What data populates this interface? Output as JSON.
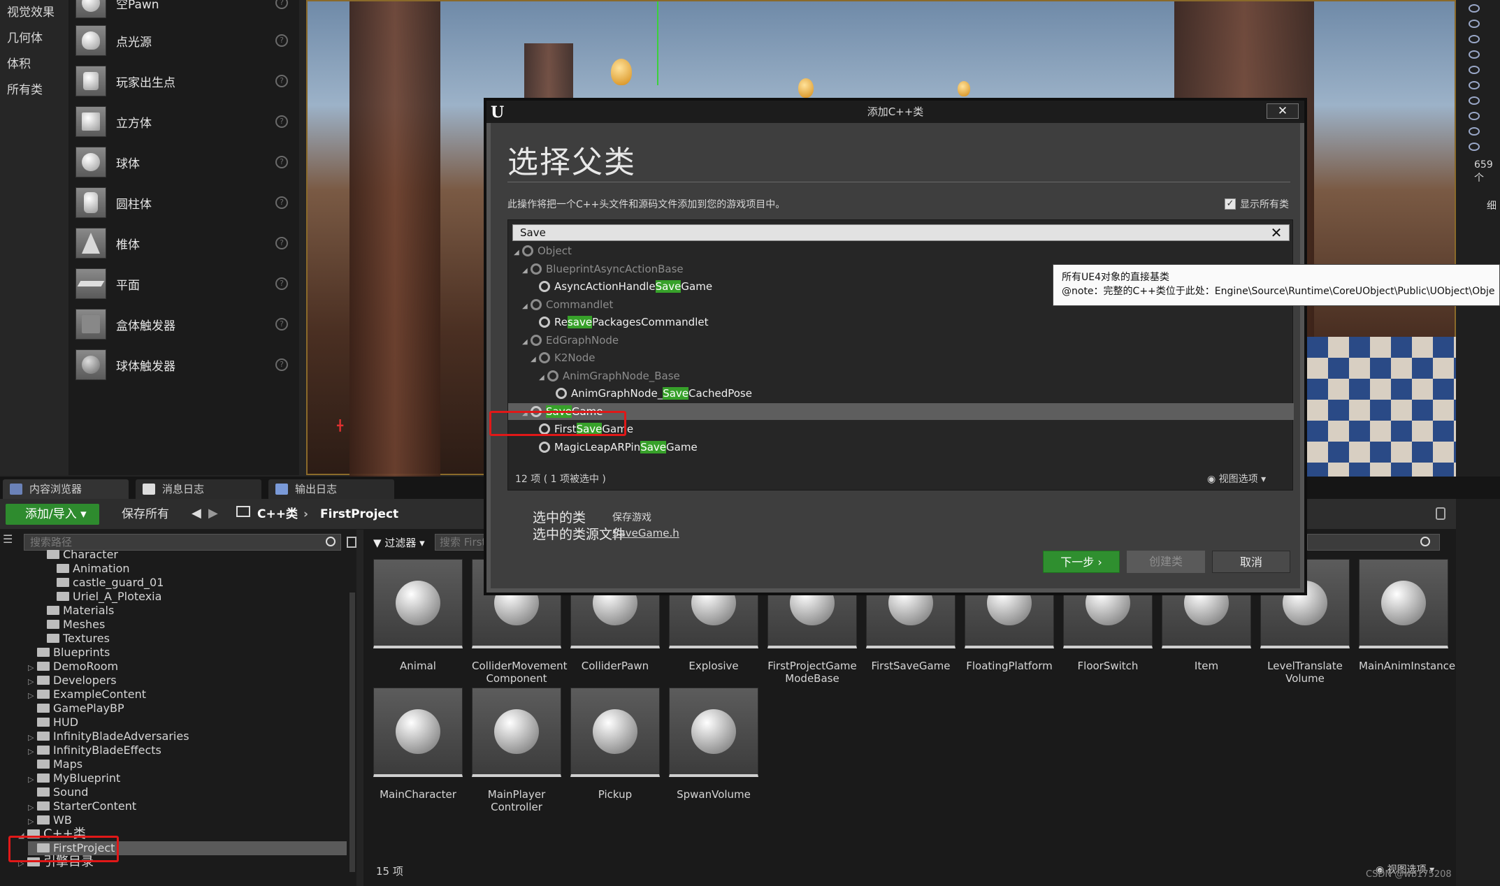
{
  "categories": [
    "视觉效果",
    "几何体",
    "体积",
    "所有类"
  ],
  "place_items": [
    {
      "label": "空Pawn"
    },
    {
      "label": "点光源"
    },
    {
      "label": "玩家出生点"
    },
    {
      "label": "立方体"
    },
    {
      "label": "球体"
    },
    {
      "label": "圆柱体"
    },
    {
      "label": "椎体"
    },
    {
      "label": "平面"
    },
    {
      "label": "盒体触发器"
    },
    {
      "label": "球体触发器"
    }
  ],
  "help_glyph": "?",
  "viewport": {
    "readout": "659个",
    "detail": "细"
  },
  "bottom_tabs": [
    "内容浏览器",
    "消息日志",
    "输出日志"
  ],
  "toolbar": {
    "add_import": "添加/导入",
    "save_all": "保存所有",
    "crumbs": [
      "C++类",
      "FirstProject"
    ]
  },
  "tree": {
    "search_placeholder": "搜索路径",
    "items": [
      {
        "label": "Character",
        "indent": 3
      },
      {
        "label": "Animation",
        "indent": 4
      },
      {
        "label": "castle_guard_01",
        "indent": 4
      },
      {
        "label": "Uriel_A_Plotexia",
        "indent": 4
      },
      {
        "label": "Materials",
        "indent": 3
      },
      {
        "label": "Meshes",
        "indent": 3
      },
      {
        "label": "Textures",
        "indent": 3
      },
      {
        "label": "Blueprints",
        "indent": 2
      },
      {
        "label": "DemoRoom",
        "indent": 2
      },
      {
        "label": "Developers",
        "indent": 2
      },
      {
        "label": "ExampleContent",
        "indent": 2
      },
      {
        "label": "GamePlayBP",
        "indent": 2
      },
      {
        "label": "HUD",
        "indent": 2
      },
      {
        "label": "InfinityBladeAdversaries",
        "indent": 2
      },
      {
        "label": "InfinityBladeEffects",
        "indent": 2
      },
      {
        "label": "Maps",
        "indent": 2
      },
      {
        "label": "MyBlueprint",
        "indent": 2
      },
      {
        "label": "Sound",
        "indent": 2
      },
      {
        "label": "StarterContent",
        "indent": 2
      },
      {
        "label": "WB",
        "indent": 2
      },
      {
        "label": "C++类",
        "indent": 1
      },
      {
        "label": "FirstProject",
        "indent": 2
      },
      {
        "label": "引擎目录",
        "indent": 1
      }
    ]
  },
  "assets": {
    "filter": "过滤器",
    "search_placeholder": "搜索 FirstProject",
    "count": "15 项",
    "view_options": "视图选项",
    "tiles": [
      {
        "label": "Animal"
      },
      {
        "label": "ColliderMovement Component"
      },
      {
        "label": "ColliderPawn"
      },
      {
        "label": "Explosive"
      },
      {
        "label": "FirstProjectGame ModeBase"
      },
      {
        "label": "FirstSaveGame"
      },
      {
        "label": "FloatingPlatform"
      },
      {
        "label": "FloorSwitch"
      },
      {
        "label": "Item"
      },
      {
        "label": "LevelTranslate Volume"
      },
      {
        "label": "MainAnimInstance"
      },
      {
        "label": "MainCharacter"
      },
      {
        "label": "MainPlayer Controller"
      },
      {
        "label": "Pickup"
      },
      {
        "label": "SpwanVolume"
      }
    ],
    "watermark": "CSDN @wb175208"
  },
  "dialog": {
    "logo": "U",
    "title": "添加C++类",
    "close": "✕",
    "heading": "选择父类",
    "description": "此操作将把一个C++头文件和源码文件添加到您的游戏项目中。",
    "show_all_label": "显示所有类",
    "show_all_checked": true,
    "search_value": "Save",
    "search_clear": "✕",
    "classes": [
      {
        "pre": "Object",
        "hl": "",
        "post": "",
        "level": 0,
        "dim": true,
        "tri": "◢"
      },
      {
        "pre": "BlueprintAsyncActionBase",
        "hl": "",
        "post": "",
        "level": 1,
        "dim": true,
        "tri": "◢"
      },
      {
        "pre": "AsyncActionHandle",
        "hl": "Save",
        "post": "Game",
        "level": 2,
        "dim": false,
        "tri": ""
      },
      {
        "pre": "Commandlet",
        "hl": "",
        "post": "",
        "level": 1,
        "dim": true,
        "tri": "◢"
      },
      {
        "pre": "Re",
        "hl": "save",
        "post": "PackagesCommandlet",
        "level": 2,
        "dim": false,
        "tri": ""
      },
      {
        "pre": "EdGraphNode",
        "hl": "",
        "post": "",
        "level": 1,
        "dim": true,
        "tri": "◢"
      },
      {
        "pre": "K2Node",
        "hl": "",
        "post": "",
        "level": 2,
        "dim": true,
        "tri": "◢"
      },
      {
        "pre": "AnimGraphNode_Base",
        "hl": "",
        "post": "",
        "level": 3,
        "dim": true,
        "tri": "◢"
      },
      {
        "pre": "AnimGraphNode_",
        "hl": "Save",
        "post": "CachedPose",
        "level": 4,
        "dim": false,
        "tri": ""
      },
      {
        "pre": "",
        "hl": "Save",
        "post": "Game",
        "level": 1,
        "dim": false,
        "tri": "◢",
        "selected": true
      },
      {
        "pre": "First",
        "hl": "Save",
        "post": "Game",
        "level": 2,
        "dim": false,
        "tri": ""
      },
      {
        "pre": "MagicLeapARPin",
        "hl": "Save",
        "post": "Game",
        "level": 2,
        "dim": false,
        "tri": ""
      }
    ],
    "count": "12 项 ( 1 项被选中 )",
    "view_options": "视图选项",
    "selected_class_label": "选中的类",
    "selected_class_value": "保存游戏",
    "selected_source_label": "选中的类源文件",
    "selected_source_value": "SaveGame.h",
    "btn_next": "下一步 ›",
    "btn_create": "创建类",
    "btn_cancel": "取消"
  },
  "tooltip": {
    "line1": "所有UE4对象的直接基类",
    "line2": "@note：完整的C++类位于此处：Engine\\Source\\Runtime\\CoreUObject\\Public\\UObject\\Obje"
  },
  "colors": {
    "accent_green": "#37a12a",
    "highlight_red": "#e01818"
  }
}
